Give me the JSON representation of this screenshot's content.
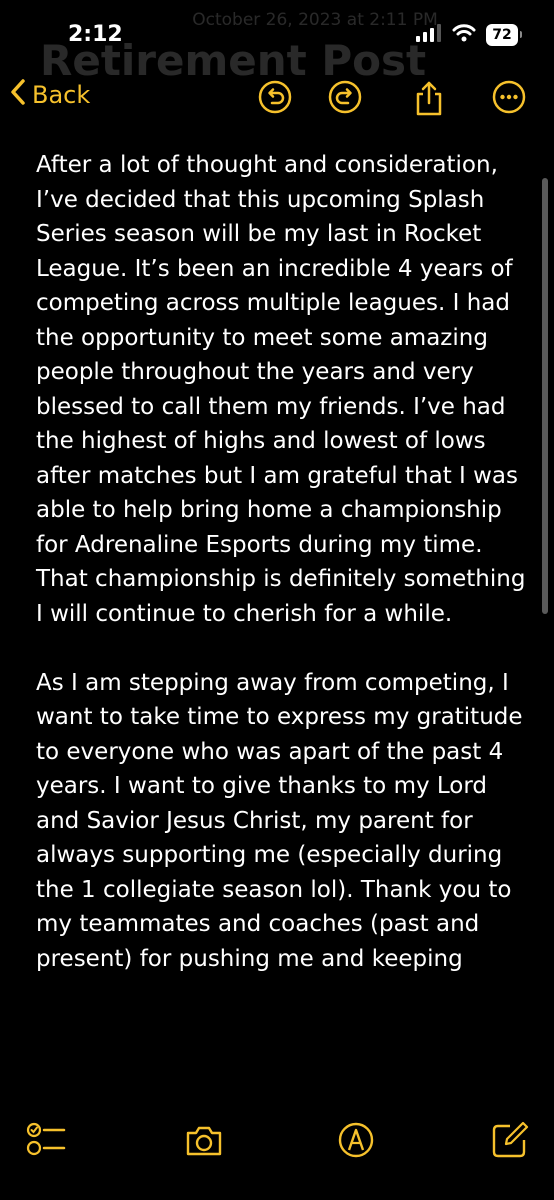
{
  "status": {
    "time": "2:12",
    "battery": "72"
  },
  "ghost": {
    "date": "October 26, 2023 at 2:11 PM",
    "title": "Retirement Post"
  },
  "nav": {
    "back_label": "Back"
  },
  "note": {
    "paragraphs": [
      "After a lot of thought and consideration, I’ve decided that this upcoming Splash Series season will be my last in Rocket League. It’s been an incredible 4 years of competing across multiple leagues. I had the opportunity to meet some amazing people throughout the years and very blessed to call them my friends. I’ve had the highest of highs and lowest of lows after matches but I am grateful that I was able to help bring home a championship for Adrenaline Esports during my time. That championship is definitely something I will continue to cherish for a while.",
      "As I am stepping away from competing, I want to take time to express my gratitude to everyone who was apart of the past 4 years. I want to give thanks to my Lord and Savior Jesus Christ, my parent for always supporting me (especially during the 1 collegiate season lol). Thank you to my teammates and coaches (past and present) for pushing me and keeping"
    ]
  },
  "colors": {
    "accent": "#f6c12c",
    "background": "#000000",
    "text": "#ffffff"
  },
  "icons": [
    "signal-icon",
    "wifi-icon",
    "battery-icon",
    "chevron-left-icon",
    "undo-icon",
    "redo-icon",
    "share-icon",
    "more-icon",
    "checklist-icon",
    "camera-icon",
    "markup-icon",
    "compose-icon"
  ]
}
